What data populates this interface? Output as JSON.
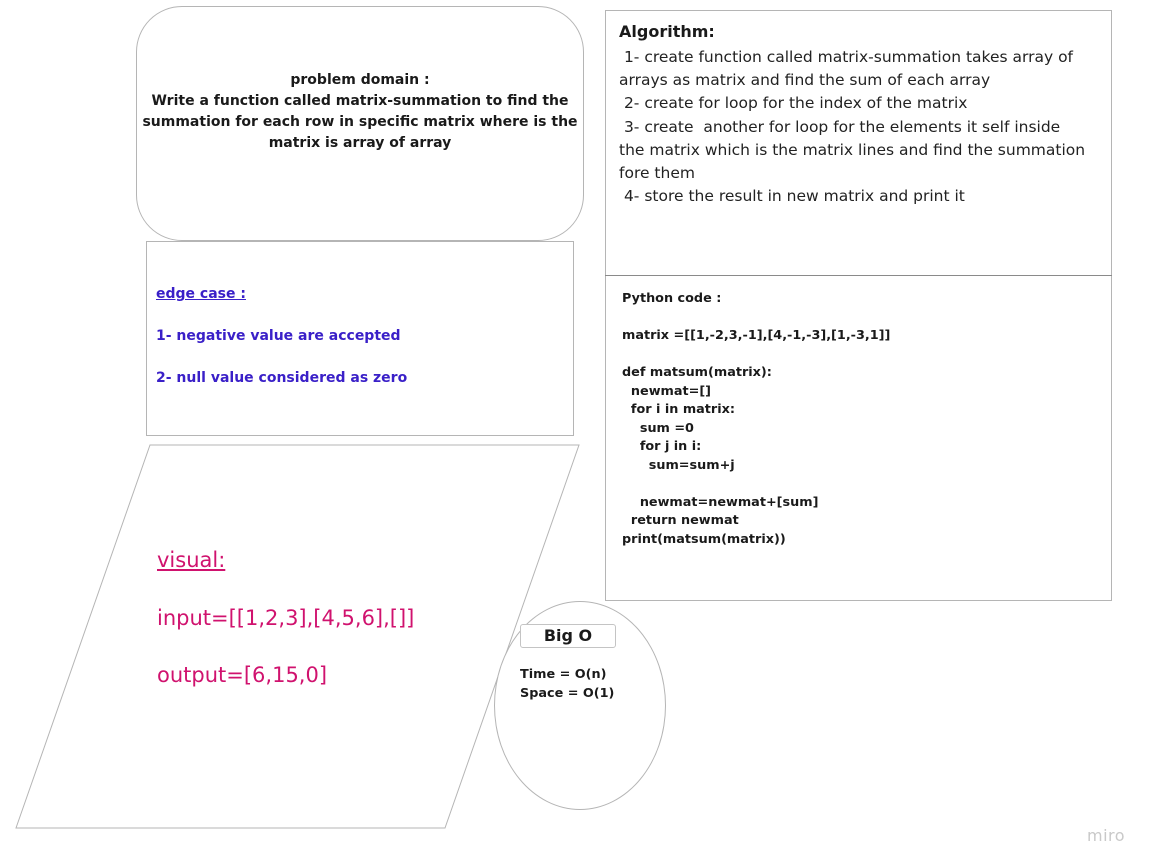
{
  "problem_domain": {
    "lines": [
      "problem domain :",
      "Write a function called matrix-summation to find the",
      "summation for each row in specific matrix where is the",
      "matrix is array of array"
    ]
  },
  "edge_case": {
    "title": "edge case :",
    "items": [
      "1- negative value are accepted",
      "2- null value considered as zero"
    ]
  },
  "algorithm": {
    "title": "Algorithm:",
    "lines": [
      " 1- create function called matrix-summation takes array of",
      "arrays as matrix and find the sum of each array",
      " 2- create for loop for the index of the matrix",
      " 3- create  another for loop for the elements it self inside",
      "the matrix which is the matrix lines and find the summation",
      "fore them",
      " 4- store the result in new matrix and print it"
    ]
  },
  "python_code": {
    "lines": [
      "Python code :",
      "",
      "matrix =[[1,-2,3,-1],[4,-1,-3],[1,-3,1]]",
      "",
      "def matsum(matrix):",
      "  newmat=[]",
      "  for i in matrix:",
      "    sum =0",
      "    for j in i:",
      "      sum=sum+j",
      "",
      "    newmat=newmat+[sum]",
      "  return newmat",
      "print(matsum(matrix))"
    ]
  },
  "visual": {
    "title": "visual:",
    "input": "input=[[1,2,3],[4,5,6],[]]",
    "output": "output=[6,15,0]"
  },
  "big_o": {
    "title": "Big O",
    "time": "Time = O(n)",
    "space": "Space = O(1)"
  },
  "watermark": "miro",
  "colors": {
    "edge_case_text": "#3a20c8",
    "visual_text": "#d0126e",
    "border": "#b5b5b5"
  }
}
